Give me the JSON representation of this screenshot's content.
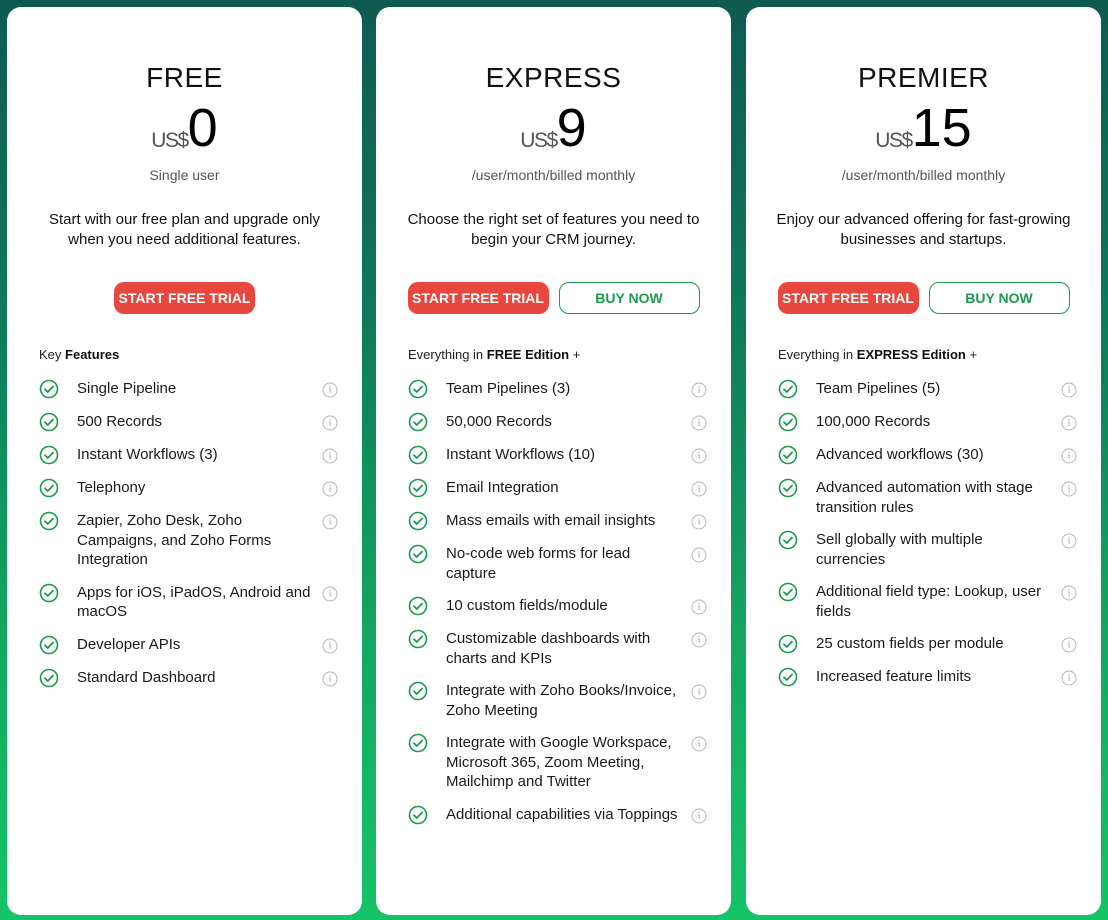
{
  "plans": [
    {
      "name": "FREE",
      "currency": "US$",
      "price": "0",
      "subtitle": "Single user",
      "description": "Start with our free plan and upgrade only when you need additional features.",
      "trial_label": "START FREE TRIAL",
      "buy_label": null,
      "features_heading_prefix": "Key",
      "features_heading_bold": "Features",
      "features_heading_suffix": "",
      "features": [
        "Single Pipeline",
        "500 Records",
        "Instant Workflows (3)",
        "Telephony",
        "Zapier, Zoho Desk, Zoho Campaigns, and Zoho Forms Integration",
        "Apps for iOS, iPadOS, Android and macOS",
        "Developer APIs",
        "Standard Dashboard"
      ]
    },
    {
      "name": "EXPRESS",
      "currency": "US$",
      "price": "9",
      "subtitle": "/user/month/billed monthly",
      "description": "Choose the right set of features you need to begin your CRM journey.",
      "trial_label": "START FREE TRIAL",
      "buy_label": "BUY NOW",
      "features_heading_prefix": "Everything in",
      "features_heading_bold": "FREE Edition",
      "features_heading_suffix": "+",
      "features": [
        "Team Pipelines (3)",
        "50,000 Records",
        "Instant Workflows (10)",
        "Email Integration",
        "Mass emails with email insights",
        "No-code web forms for lead capture",
        "10 custom fields/module",
        "Customizable dashboards with charts and KPIs",
        "Integrate with Zoho Books/Invoice, Zoho Meeting",
        "Integrate with Google Workspace, Microsoft 365, Zoom Meeting, Mailchimp and Twitter",
        "Additional capabilities via Toppings"
      ]
    },
    {
      "name": "PREMIER",
      "currency": "US$",
      "price": "15",
      "subtitle": "/user/month/billed monthly",
      "description": "Enjoy our advanced offering for fast-growing businesses and startups.",
      "trial_label": "START FREE TRIAL",
      "buy_label": "BUY NOW",
      "features_heading_prefix": "Everything in",
      "features_heading_bold": "EXPRESS Edition",
      "features_heading_suffix": "+",
      "features": [
        "Team Pipelines (5)",
        "100,000 Records",
        "Advanced workflows (30)",
        "Advanced automation with stage transition rules",
        "Sell globally with multiple currencies",
        "Additional field type: Lookup, user fields",
        "25 custom fields per module",
        "Increased feature limits"
      ]
    }
  ],
  "icons": {
    "feature_check": "check-circle-icon",
    "feature_info": "info-icon"
  },
  "colors": {
    "trial_button": "#e8473e",
    "buy_button": "#1a9b4c",
    "check": "#1a9b4c"
  }
}
